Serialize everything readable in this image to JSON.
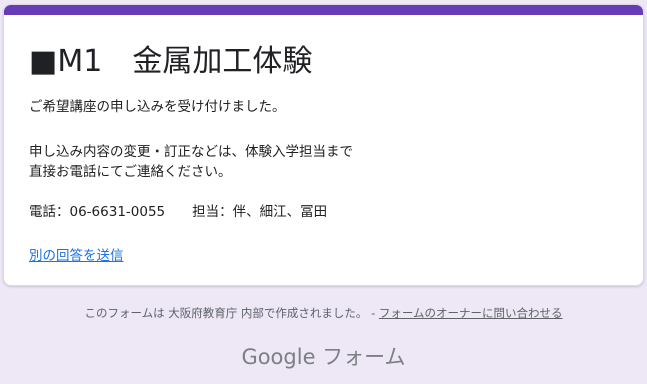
{
  "form": {
    "title": "■M1　金属加工体験",
    "confirmation": "ご希望講座の申し込みを受け付けました。",
    "instructions_line1": "申し込み内容の変更・訂正などは、体験入学担当まで",
    "instructions_line2": "直接お電話にてご連絡ください。",
    "contact": "電話：06-6631-0055　　担当：伴、細江、冨田",
    "submit_another_link": "別の回答を送信"
  },
  "footer": {
    "created_by": "このフォームは 大阪府教育庁 内部で作成されました。 - ",
    "contact_owner_link": "フォームのオーナーに問い合わせる"
  },
  "brand": {
    "name": "Google フォーム"
  },
  "colors": {
    "accent": "#673ab7",
    "background": "#ede7f6",
    "link": "#1a73e8"
  }
}
